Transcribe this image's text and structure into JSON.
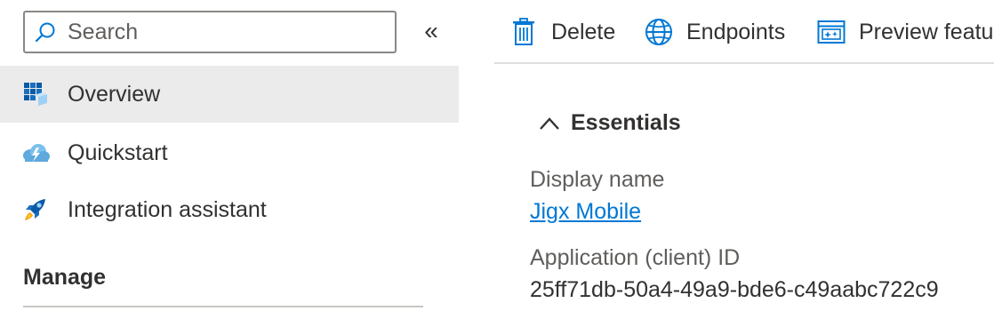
{
  "search": {
    "placeholder": "Search"
  },
  "sidebar": {
    "collapse_glyph": "«",
    "items": [
      {
        "label": "Overview",
        "icon": "overview-grid-icon",
        "selected": true
      },
      {
        "label": "Quickstart",
        "icon": "cloud-lightning-icon",
        "selected": false
      },
      {
        "label": "Integration assistant",
        "icon": "rocket-icon",
        "selected": false
      }
    ],
    "section_header": "Manage"
  },
  "toolbar": {
    "items": [
      {
        "label": "Delete",
        "icon": "trash-icon"
      },
      {
        "label": "Endpoints",
        "icon": "globe-icon"
      },
      {
        "label": "Preview features",
        "icon": "preview-window-icon"
      }
    ]
  },
  "essentials": {
    "title": "Essentials",
    "display_name_label": "Display name",
    "display_name_value": "Jigx Mobile",
    "app_id_label": "Application (client) ID",
    "app_id_value": "25ff71db-50a4-49a9-bde6-c49aabc722c9"
  },
  "colors": {
    "accent": "#0078d4",
    "selected_bg": "#ebebeb",
    "text": "#323130",
    "muted_text": "#605e5c",
    "border": "#8a8886"
  }
}
